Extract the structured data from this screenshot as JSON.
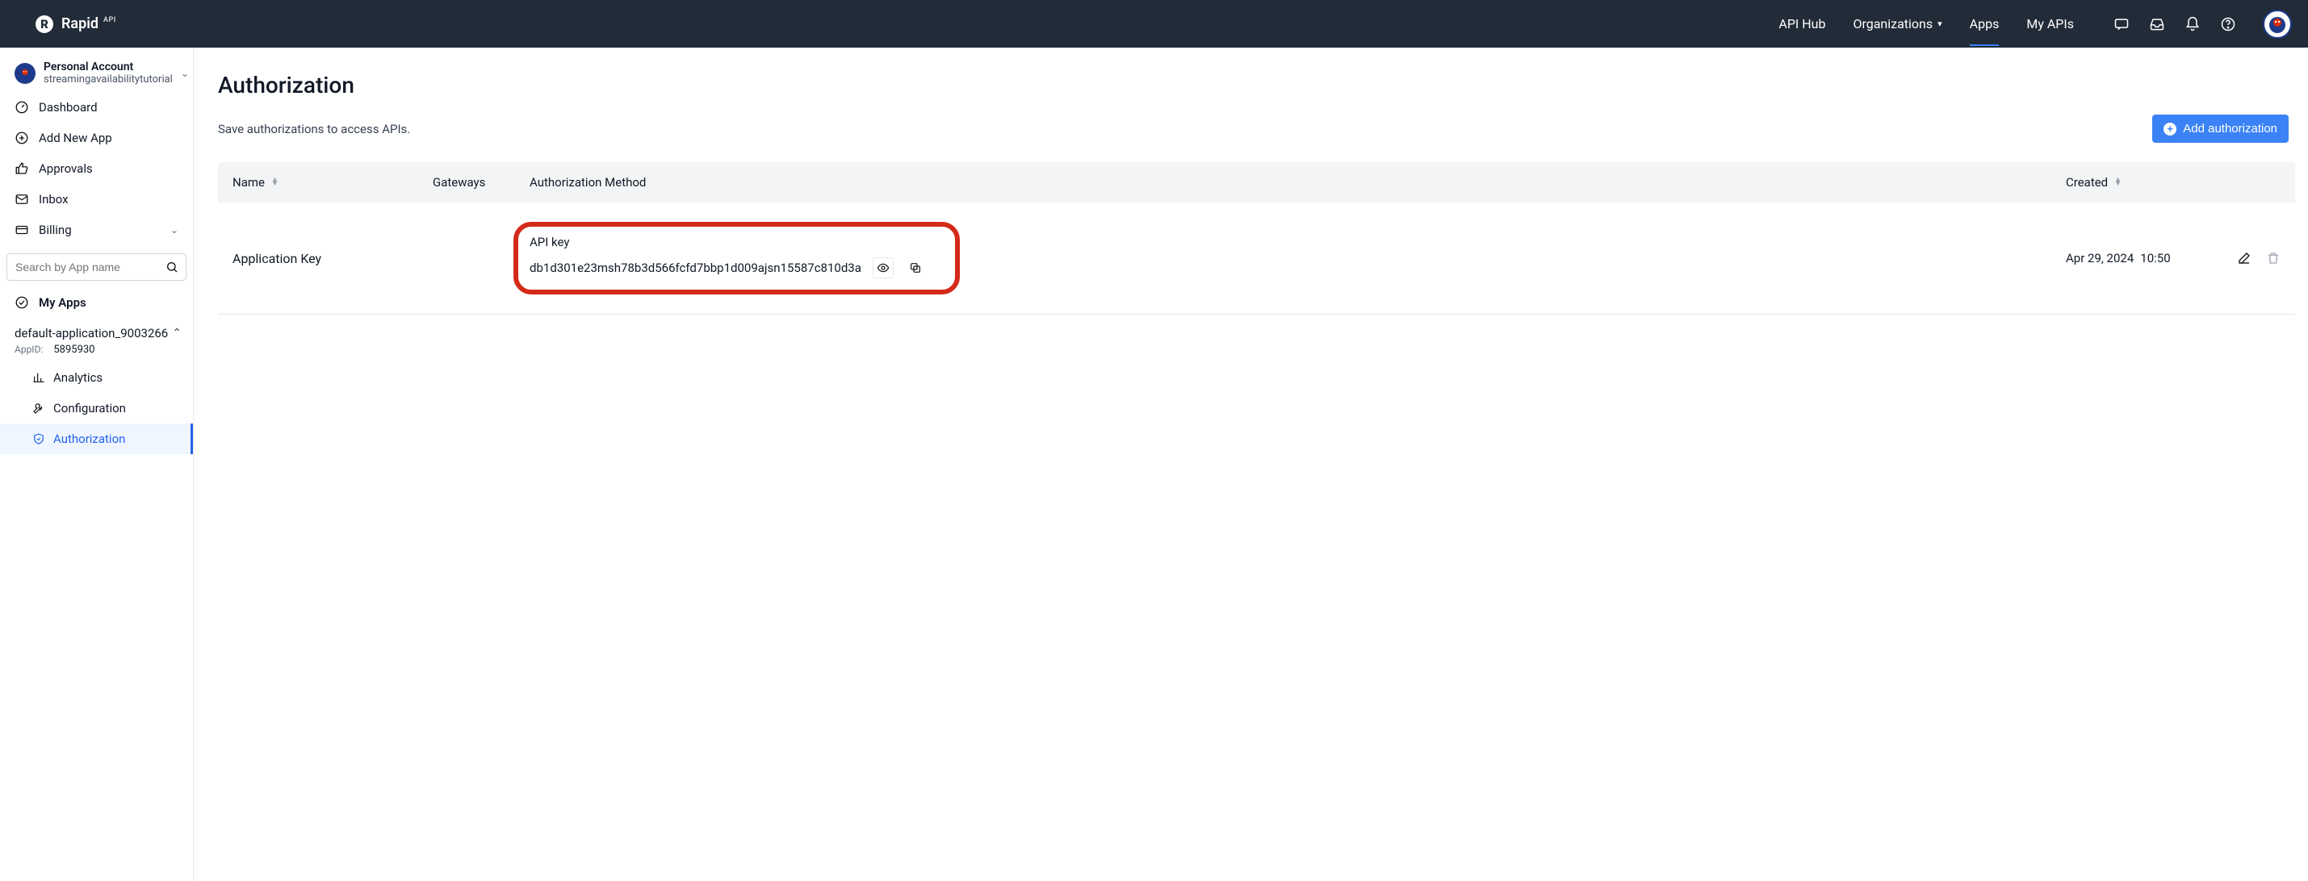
{
  "brand": {
    "name": "Rapid",
    "sup": "API"
  },
  "topnav": {
    "api_hub": "API Hub",
    "organizations": "Organizations",
    "apps": "Apps",
    "my_apis": "My APIs"
  },
  "account": {
    "label": "Personal Account",
    "username": "streamingavailabilitytutorial"
  },
  "sidebar": {
    "dashboard": "Dashboard",
    "add_new_app": "Add New App",
    "approvals": "Approvals",
    "inbox": "Inbox",
    "billing": "Billing",
    "search_placeholder": "Search by App name",
    "my_apps": "My Apps",
    "app_name": "default-application_9003266",
    "app_id_label": "AppID:",
    "app_id_value": "5895930",
    "analytics": "Analytics",
    "configuration": "Configuration",
    "authorization": "Authorization"
  },
  "page": {
    "title": "Authorization",
    "subtitle": "Save authorizations to access APIs.",
    "add_button": "Add authorization"
  },
  "table": {
    "headers": {
      "name": "Name",
      "gateways": "Gateways",
      "method": "Authorization Method",
      "created": "Created"
    },
    "rows": [
      {
        "name": "Application Key",
        "method_title": "API key",
        "method_key": "db1d301e23msh78b3d566fcfd7bbp1d009ajsn15587c810d3a",
        "created_line1": "Apr 29, 2024",
        "created_line2": "10:50"
      }
    ]
  }
}
